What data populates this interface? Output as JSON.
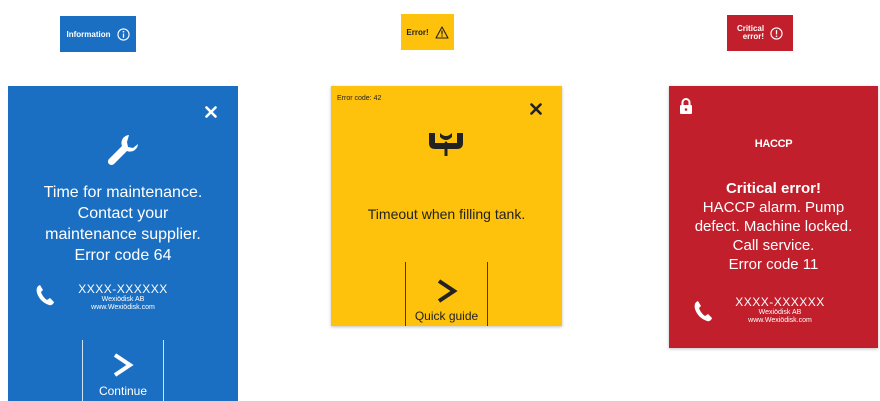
{
  "colors": {
    "blue": "#1b6fc2",
    "yellow": "#fec20c",
    "red": "#c01f2b"
  },
  "badges": {
    "info": {
      "label": "Information",
      "icon": "info-circle-icon"
    },
    "error": {
      "label": "Error!",
      "icon": "warning-triangle-icon"
    },
    "critical": {
      "line1": "Critical",
      "line2": "error!",
      "icon": "exclamation-circle-icon"
    }
  },
  "maintenance_panel": {
    "icon": "wrench-icon",
    "lines": [
      "Time for maintenance.",
      "Contact your",
      "maintenance supplier.",
      "Error code 64"
    ],
    "contact": {
      "phone": "XXXX-XXXXXX",
      "company": "Wexiödisk AB",
      "website": "www.Wexiödisk.com",
      "icon": "phone-icon"
    },
    "button_label": "Continue",
    "close_icon": "close-icon"
  },
  "error_panel": {
    "error_code": "Error code: 42",
    "icon": "tank-fill-icon",
    "message": "Timeout when filling tank.",
    "button_label": "Quick guide",
    "close_icon": "close-icon"
  },
  "critical_panel": {
    "lock_icon": "lock-icon",
    "title": "HACCP",
    "heading": "Critical error!",
    "lines": [
      "HACCP alarm. Pump",
      "defect. Machine locked.",
      "Call service.",
      "Error code 11"
    ],
    "contact": {
      "phone": "XXXX-XXXXXX",
      "company": "Wexiödisk AB",
      "website": "www.Wexiödisk.com",
      "icon": "phone-icon"
    }
  }
}
